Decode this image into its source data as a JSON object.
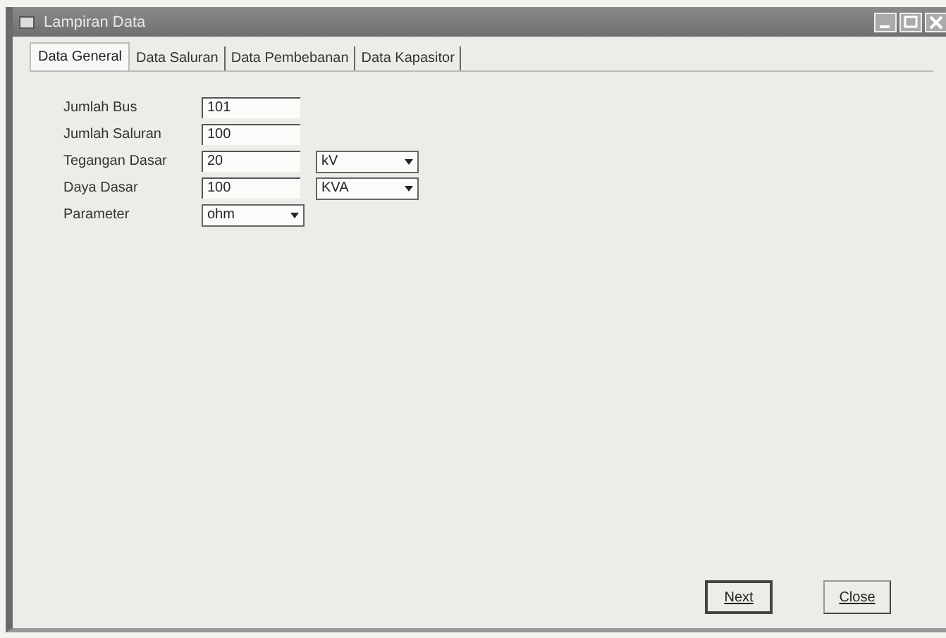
{
  "window": {
    "title": "Lampiran Data"
  },
  "tabs": [
    {
      "label": "Data General",
      "selected": true
    },
    {
      "label": "Data Saluran",
      "selected": false
    },
    {
      "label": "Data Pembebanan",
      "selected": false
    },
    {
      "label": "Data Kapasitor",
      "selected": false
    }
  ],
  "fields": [
    {
      "label": "Jumlah Bus",
      "value": "101"
    },
    {
      "label": "Jumlah Saluran",
      "value": "100"
    },
    {
      "label": "Tegangan Dasar",
      "value": "20",
      "unit": "kV"
    },
    {
      "label": "Daya Dasar",
      "value": "100",
      "unit": "KVA"
    },
    {
      "label": "Parameter",
      "select": "ohm"
    }
  ],
  "buttons": [
    "Next",
    "Close"
  ]
}
